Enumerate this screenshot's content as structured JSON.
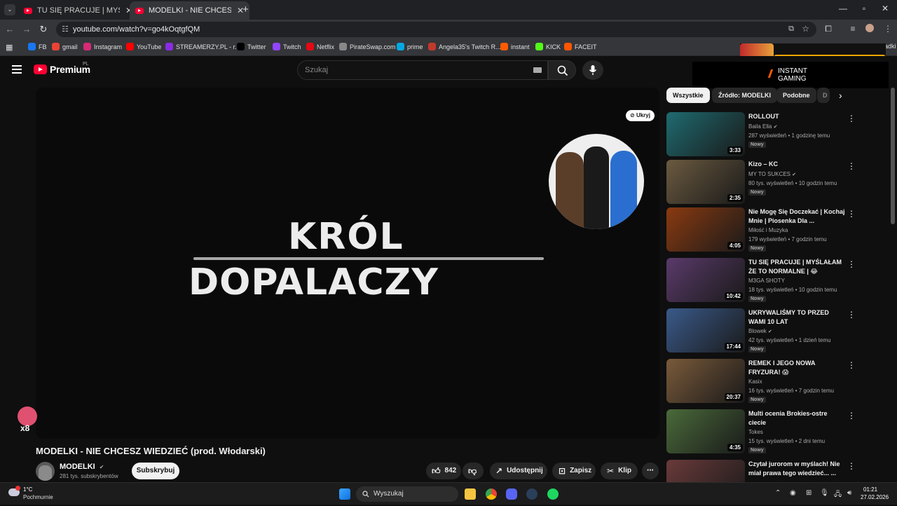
{
  "browser": {
    "tabs": [
      {
        "title": "TU SIĘ PRACUJE | MYŚLAŁAM Ż",
        "active": false
      },
      {
        "title": "MODELKI - NIE CHCESZ WIEDZIEĆ",
        "active": true
      }
    ],
    "url": "youtube.com/watch?v=go4kOqtgfQM",
    "bookmarks": [
      {
        "label": "FB",
        "color": "#1877f2"
      },
      {
        "label": "gmail",
        "color": "#ea4335"
      },
      {
        "label": "Instagram",
        "color": "#d62976"
      },
      {
        "label": "YouTube",
        "color": "#ff0000"
      },
      {
        "label": "STREAMERZY.PL - r...",
        "color": "#8a2be2"
      },
      {
        "label": "Twitter",
        "color": "#000000"
      },
      {
        "label": "Twitch",
        "color": "#9146ff"
      },
      {
        "label": "Netflix",
        "color": "#e50914"
      },
      {
        "label": "PirateSwap.com",
        "color": "#888888"
      },
      {
        "label": "prime",
        "color": "#00a8e1"
      },
      {
        "label": "Angela35's Twitch R...",
        "color": "#c0392b"
      },
      {
        "label": "instant",
        "color": "#ff5a00"
      },
      {
        "label": "KICK",
        "color": "#53fc18"
      },
      {
        "label": "FACEIT",
        "color": "#ff5500"
      }
    ],
    "bookmarks_other": "Wszystkie zakładki"
  },
  "youtube": {
    "logo_text": "Premium",
    "logo_region": "PL",
    "search_placeholder": "Szukaj",
    "ad": {
      "line1": "INSTANT",
      "line2": "GAMING"
    },
    "player": {
      "title_line1": "KRÓL",
      "title_line2": "DOPALACZY",
      "hide_label": "Ukryj"
    },
    "video_title": "MODELKI - NIE CHCESZ WIEDZIEĆ (prod. Włodarski)",
    "channel": {
      "name": "MODELKI",
      "subs": "281 tys. subskrybentów"
    },
    "subscribe_label": "Subskrybuj",
    "actions": {
      "likes": "842",
      "share": "Udostępnij",
      "save": "Zapisz",
      "clip": "Klip"
    },
    "chips": [
      "Wszystkie",
      "Źródło: MODELKI",
      "Podobne",
      "D"
    ],
    "recommendations": [
      {
        "title": "ROLLOUT",
        "channel": "Baila Ella",
        "verified": true,
        "views": "287 wyświetleń • 1 godzinę temu",
        "duration": "3:33",
        "badge": "Nowy",
        "thumb": "#1e6b70"
      },
      {
        "title": "Kizo – KC",
        "channel": "MY TO SUKCES",
        "verified": true,
        "views": "80 tys. wyświetleń • 10 godzin temu",
        "duration": "2:35",
        "badge": "Nowy",
        "thumb": "#6b5a40"
      },
      {
        "title": "Nie Mogę Się Doczekać | Kochaj Mnie | Piosenka Dla ...",
        "channel": "Miłość i Muzyka",
        "verified": false,
        "views": "179 wyświetleń • 7 godzin temu",
        "duration": "4:05",
        "badge": "Nowy",
        "thumb": "#8a3a10"
      },
      {
        "title": "TU SIĘ PRACUJE | MYŚLAŁAM ŻE TO NORMALNE | 😂 POLSK...",
        "channel": "M3GA SHOTY",
        "verified": false,
        "views": "18 tys. wyświetleń • 10 godzin temu",
        "duration": "10:42",
        "badge": "Nowy",
        "thumb": "#5a3a6a"
      },
      {
        "title": "UKRYWALIŚMY TO PRZED WAMI 10 LAT",
        "channel": "Blowek",
        "verified": true,
        "views": "42 tys. wyświetleń • 1 dzień temu",
        "duration": "17:44",
        "badge": "Nowy",
        "thumb": "#3a5a8a"
      },
      {
        "title": "REMEK I JEGO NOWA FRYZURA! 😱",
        "channel": "Kasix",
        "verified": false,
        "views": "16 tys. wyświetleń • 7 godzin temu",
        "duration": "20:37",
        "badge": "Nowy",
        "thumb": "#7a5a3a"
      },
      {
        "title": "Multi ocenia Brokies-ostre ciecie",
        "channel": "Tokes",
        "verified": false,
        "views": "15 tys. wyświetleń • 2 dni temu",
        "duration": "4:35",
        "badge": "Nowy",
        "thumb": "#4a6a3a"
      },
      {
        "title": "Czytał jurorom w myślach! Nie miał prawa tego wiedzieć... ...",
        "channel": "",
        "verified": false,
        "views": "",
        "duration": "",
        "badge": "",
        "thumb": "#6a3a3a"
      }
    ]
  },
  "taskbar": {
    "weather_temp": "1°C",
    "weather_desc": "Pochmurnie",
    "search_label": "Wyszukaj",
    "time": "01:21",
    "date": "27.02.2026"
  }
}
